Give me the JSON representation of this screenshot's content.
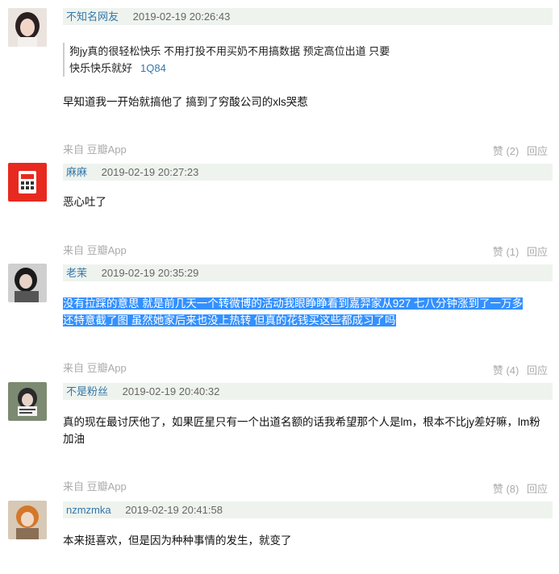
{
  "comments": [
    {
      "author": "不知名网友",
      "time": "2019-02-19 20:26:43",
      "quote_text": "狗jy真的很轻松快乐 不用打投不用买奶不用搞数据 预定高位出道 只要快乐快乐就好",
      "quote_ref": "1Q84",
      "text": "早知道我一开始就搞他了 搞到了穷酸公司的xls哭惹",
      "source": "来自 豆瓣App",
      "like_label": "赞 (2)",
      "reply_label": "回应"
    },
    {
      "author": "麻麻",
      "time": "2019-02-19 20:27:23",
      "text": "恶心吐了",
      "source": "来自 豆瓣App",
      "like_label": "赞 (1)",
      "reply_label": "回应"
    },
    {
      "author": "老茉",
      "time": "2019-02-19 20:35:29",
      "text_line1": "没有拉踩的意思 就是前几天一个转微博的活动我眼睁睁看到嘉羿家从927 七八分钟涨到了一万多",
      "text_line2": "还特意截了图 虽然她家后来也没上热转 但真的花钱买这些都成习了吗",
      "source": "来自 豆瓣App",
      "like_label": "赞 (4)",
      "reply_label": "回应"
    },
    {
      "author": "不是粉丝",
      "time": "2019-02-19 20:40:32",
      "text": "真的现在最讨厌他了，如果匠星只有一个出道名额的话我希望那个人是lm，根本不比jy差好嘛，lm粉加油",
      "source": "来自 豆瓣App",
      "like_label": "赞 (8)",
      "reply_label": "回应"
    },
    {
      "author": "nzmzmka",
      "time": "2019-02-19 20:41:58",
      "text": "本来挺喜欢，但是因为种种事情的发生，就变了"
    }
  ],
  "colors": {
    "link": "#3377aa",
    "header_bg": "#eef3ee",
    "muted": "#aaaaaa",
    "selection": "#3390ff"
  }
}
